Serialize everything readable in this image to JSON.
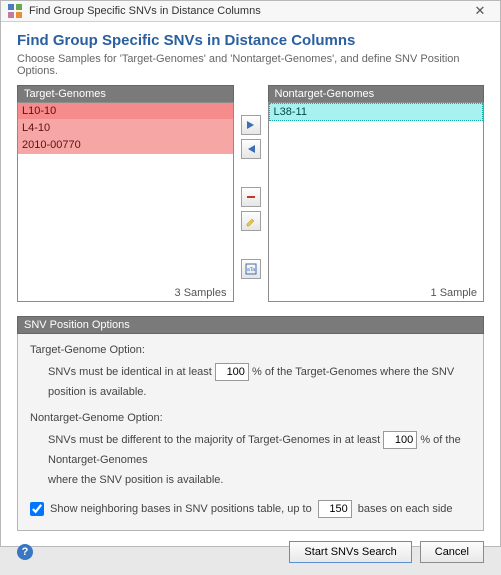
{
  "window": {
    "title": "Find Group Specific SNVs in Distance Columns"
  },
  "header": {
    "title": "Find Group Specific SNVs in Distance Columns",
    "subtitle": "Choose Samples for 'Target-Genomes' and 'Nontarget-Genomes', and define SNV Position Options."
  },
  "panels": {
    "target": {
      "title": "Target-Genomes",
      "items": [
        "L10-10",
        "L4-10",
        "2010-00770"
      ],
      "count_label": "3 Samples"
    },
    "nontarget": {
      "title": "Nontarget-Genomes",
      "items": [
        "L38-11"
      ],
      "count_label": "1 Sample"
    }
  },
  "options": {
    "title": "SNV Position Options",
    "target_label": "Target-Genome Option:",
    "target_pre": "SNVs must be identical in at least",
    "target_value": "100",
    "target_post": "% of the Target-Genomes where the SNV position is available.",
    "nontarget_label": "Nontarget-Genome Option:",
    "nontarget_pre": "SNVs must be different to the majority of Target-Genomes in at least",
    "nontarget_value": "100",
    "nontarget_mid": "% of the Nontarget-Genomes",
    "nontarget_post": "where the SNV position is available.",
    "show_neighbors_checked": true,
    "show_neighbors_pre": "Show neighboring bases in SNV positions table, up to",
    "show_neighbors_value": "150",
    "show_neighbors_post": "bases on each side"
  },
  "footer": {
    "start": "Start SNVs Search",
    "cancel": "Cancel"
  }
}
